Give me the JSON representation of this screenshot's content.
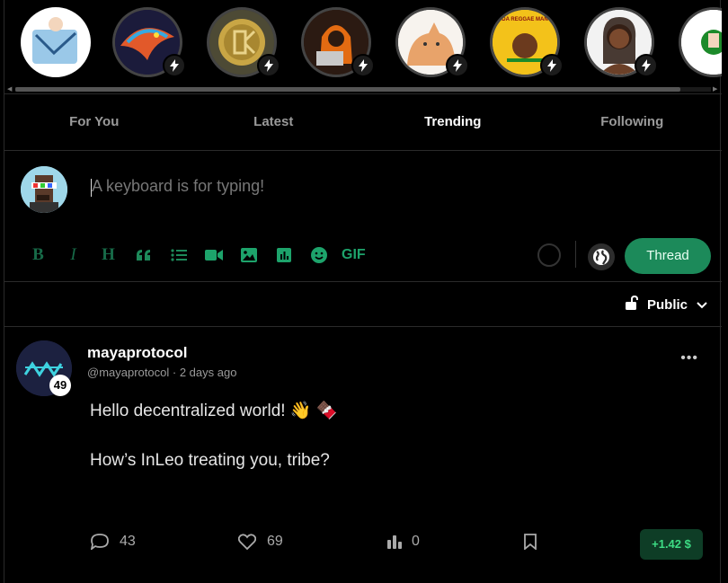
{
  "stories": [
    {
      "name": "story-1",
      "bolt": false
    },
    {
      "name": "story-2",
      "bolt": true
    },
    {
      "name": "story-3",
      "bolt": true
    },
    {
      "name": "story-4",
      "bolt": true
    },
    {
      "name": "story-5",
      "bolt": true
    },
    {
      "name": "story-6",
      "bolt": true,
      "caption": "DA REGGAE MAN"
    },
    {
      "name": "story-7",
      "bolt": true
    },
    {
      "name": "story-8",
      "bolt": false
    }
  ],
  "tabs": [
    {
      "label": "For You",
      "active": false
    },
    {
      "label": "Latest",
      "active": false
    },
    {
      "label": "Trending",
      "active": true
    },
    {
      "label": "Following",
      "active": false
    }
  ],
  "composer": {
    "placeholder": "A keyboard is for typing!",
    "tools": [
      "bold-icon",
      "italic-icon",
      "heading-icon",
      "quote-icon",
      "list-icon",
      "video-icon",
      "image-icon",
      "poll-icon",
      "emoji-icon"
    ],
    "gif_label": "GIF",
    "thread_label": "Thread"
  },
  "visibility": {
    "label": "Public"
  },
  "post": {
    "author": "mayaprotocol",
    "handle": "@mayaprotocol",
    "time": "2 days ago",
    "reputation": "49",
    "line1": "Hello decentralized world! 👋 🍫",
    "line2": "How’s InLeo treating you, tribe?",
    "comments": "43",
    "likes": "69",
    "views": "0",
    "payout": "+1.42 $"
  },
  "colors": {
    "accent": "#1c8a5a",
    "accent_text": "#1da36b",
    "payout_bg": "#0e3d26",
    "payout_text": "#3ddc84"
  }
}
